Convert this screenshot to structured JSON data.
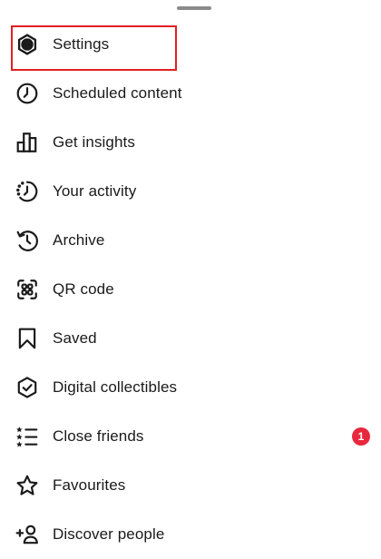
{
  "colors": {
    "badge": "#e8283d",
    "highlight": "#e02020",
    "icon": "#1a1a1a"
  },
  "menu": {
    "items": [
      {
        "icon": "settings-gear-icon",
        "label": "Settings"
      },
      {
        "icon": "clock-icon",
        "label": "Scheduled content"
      },
      {
        "icon": "bar-chart-icon",
        "label": "Get insights"
      },
      {
        "icon": "activity-clock-icon",
        "label": "Your activity"
      },
      {
        "icon": "archive-history-icon",
        "label": "Archive"
      },
      {
        "icon": "qr-code-icon",
        "label": "QR code"
      },
      {
        "icon": "bookmark-icon",
        "label": "Saved"
      },
      {
        "icon": "shield-check-icon",
        "label": "Digital collectibles"
      },
      {
        "icon": "close-friends-list-icon",
        "label": "Close friends",
        "badge": "1"
      },
      {
        "icon": "star-icon",
        "label": "Favourites"
      },
      {
        "icon": "add-person-icon",
        "label": "Discover people"
      }
    ]
  }
}
